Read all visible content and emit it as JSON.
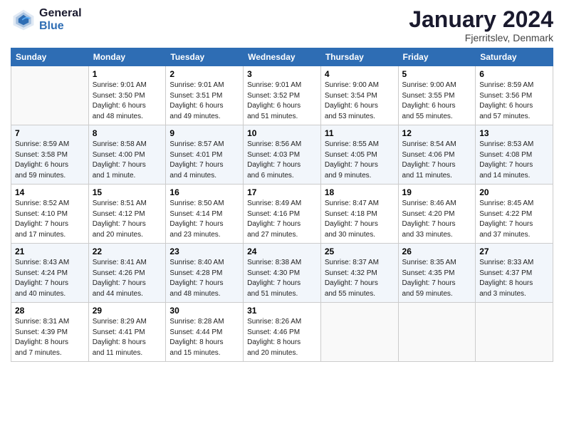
{
  "header": {
    "logo_line1": "General",
    "logo_line2": "Blue",
    "month_year": "January 2024",
    "location": "Fjerritslev, Denmark"
  },
  "weekdays": [
    "Sunday",
    "Monday",
    "Tuesday",
    "Wednesday",
    "Thursday",
    "Friday",
    "Saturday"
  ],
  "weeks": [
    [
      {
        "day": "",
        "info": ""
      },
      {
        "day": "1",
        "info": "Sunrise: 9:01 AM\nSunset: 3:50 PM\nDaylight: 6 hours\nand 48 minutes."
      },
      {
        "day": "2",
        "info": "Sunrise: 9:01 AM\nSunset: 3:51 PM\nDaylight: 6 hours\nand 49 minutes."
      },
      {
        "day": "3",
        "info": "Sunrise: 9:01 AM\nSunset: 3:52 PM\nDaylight: 6 hours\nand 51 minutes."
      },
      {
        "day": "4",
        "info": "Sunrise: 9:00 AM\nSunset: 3:54 PM\nDaylight: 6 hours\nand 53 minutes."
      },
      {
        "day": "5",
        "info": "Sunrise: 9:00 AM\nSunset: 3:55 PM\nDaylight: 6 hours\nand 55 minutes."
      },
      {
        "day": "6",
        "info": "Sunrise: 8:59 AM\nSunset: 3:56 PM\nDaylight: 6 hours\nand 57 minutes."
      }
    ],
    [
      {
        "day": "7",
        "info": "Sunrise: 8:59 AM\nSunset: 3:58 PM\nDaylight: 6 hours\nand 59 minutes."
      },
      {
        "day": "8",
        "info": "Sunrise: 8:58 AM\nSunset: 4:00 PM\nDaylight: 7 hours\nand 1 minute."
      },
      {
        "day": "9",
        "info": "Sunrise: 8:57 AM\nSunset: 4:01 PM\nDaylight: 7 hours\nand 4 minutes."
      },
      {
        "day": "10",
        "info": "Sunrise: 8:56 AM\nSunset: 4:03 PM\nDaylight: 7 hours\nand 6 minutes."
      },
      {
        "day": "11",
        "info": "Sunrise: 8:55 AM\nSunset: 4:05 PM\nDaylight: 7 hours\nand 9 minutes."
      },
      {
        "day": "12",
        "info": "Sunrise: 8:54 AM\nSunset: 4:06 PM\nDaylight: 7 hours\nand 11 minutes."
      },
      {
        "day": "13",
        "info": "Sunrise: 8:53 AM\nSunset: 4:08 PM\nDaylight: 7 hours\nand 14 minutes."
      }
    ],
    [
      {
        "day": "14",
        "info": "Sunrise: 8:52 AM\nSunset: 4:10 PM\nDaylight: 7 hours\nand 17 minutes."
      },
      {
        "day": "15",
        "info": "Sunrise: 8:51 AM\nSunset: 4:12 PM\nDaylight: 7 hours\nand 20 minutes."
      },
      {
        "day": "16",
        "info": "Sunrise: 8:50 AM\nSunset: 4:14 PM\nDaylight: 7 hours\nand 23 minutes."
      },
      {
        "day": "17",
        "info": "Sunrise: 8:49 AM\nSunset: 4:16 PM\nDaylight: 7 hours\nand 27 minutes."
      },
      {
        "day": "18",
        "info": "Sunrise: 8:47 AM\nSunset: 4:18 PM\nDaylight: 7 hours\nand 30 minutes."
      },
      {
        "day": "19",
        "info": "Sunrise: 8:46 AM\nSunset: 4:20 PM\nDaylight: 7 hours\nand 33 minutes."
      },
      {
        "day": "20",
        "info": "Sunrise: 8:45 AM\nSunset: 4:22 PM\nDaylight: 7 hours\nand 37 minutes."
      }
    ],
    [
      {
        "day": "21",
        "info": "Sunrise: 8:43 AM\nSunset: 4:24 PM\nDaylight: 7 hours\nand 40 minutes."
      },
      {
        "day": "22",
        "info": "Sunrise: 8:41 AM\nSunset: 4:26 PM\nDaylight: 7 hours\nand 44 minutes."
      },
      {
        "day": "23",
        "info": "Sunrise: 8:40 AM\nSunset: 4:28 PM\nDaylight: 7 hours\nand 48 minutes."
      },
      {
        "day": "24",
        "info": "Sunrise: 8:38 AM\nSunset: 4:30 PM\nDaylight: 7 hours\nand 51 minutes."
      },
      {
        "day": "25",
        "info": "Sunrise: 8:37 AM\nSunset: 4:32 PM\nDaylight: 7 hours\nand 55 minutes."
      },
      {
        "day": "26",
        "info": "Sunrise: 8:35 AM\nSunset: 4:35 PM\nDaylight: 7 hours\nand 59 minutes."
      },
      {
        "day": "27",
        "info": "Sunrise: 8:33 AM\nSunset: 4:37 PM\nDaylight: 8 hours\nand 3 minutes."
      }
    ],
    [
      {
        "day": "28",
        "info": "Sunrise: 8:31 AM\nSunset: 4:39 PM\nDaylight: 8 hours\nand 7 minutes."
      },
      {
        "day": "29",
        "info": "Sunrise: 8:29 AM\nSunset: 4:41 PM\nDaylight: 8 hours\nand 11 minutes."
      },
      {
        "day": "30",
        "info": "Sunrise: 8:28 AM\nSunset: 4:44 PM\nDaylight: 8 hours\nand 15 minutes."
      },
      {
        "day": "31",
        "info": "Sunrise: 8:26 AM\nSunset: 4:46 PM\nDaylight: 8 hours\nand 20 minutes."
      },
      {
        "day": "",
        "info": ""
      },
      {
        "day": "",
        "info": ""
      },
      {
        "day": "",
        "info": ""
      }
    ]
  ]
}
